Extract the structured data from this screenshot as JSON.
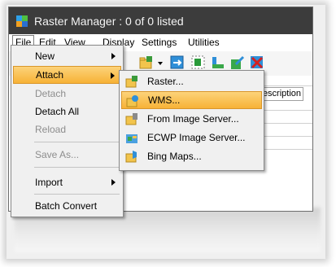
{
  "window": {
    "title": "Raster Manager : 0 of 0 listed"
  },
  "menubar": {
    "items": [
      "File",
      "Edit",
      "View",
      "Display",
      "Settings",
      "Utilities"
    ]
  },
  "list": {
    "description_header": "Description"
  },
  "file_menu": {
    "items": [
      {
        "label": "New",
        "disabled": false,
        "submenu": true
      },
      {
        "label": "Attach",
        "disabled": false,
        "submenu": true,
        "highlighted": true
      },
      {
        "label": "Detach",
        "disabled": true
      },
      {
        "label": "Detach All",
        "disabled": false
      },
      {
        "label": "Reload",
        "disabled": true
      },
      {
        "label": "Save As...",
        "disabled": true
      },
      {
        "label": "Import",
        "disabled": false,
        "submenu": true
      },
      {
        "label": "Batch Convert",
        "disabled": false
      }
    ]
  },
  "attach_submenu": {
    "items": [
      {
        "label": "Raster...",
        "icon": "raster-folder-icon"
      },
      {
        "label": "WMS...",
        "icon": "wms-folder-icon",
        "highlighted": true
      },
      {
        "label": "From Image Server...",
        "icon": "image-server-icon"
      },
      {
        "label": "ECWP Image Server...",
        "icon": "ecwp-server-icon"
      },
      {
        "label": "Bing Maps...",
        "icon": "bing-maps-icon"
      }
    ]
  },
  "colors": {
    "titlebar": "#3c3c3c",
    "highlight": "#f7b236",
    "menu_bg": "#f0f0f0"
  }
}
